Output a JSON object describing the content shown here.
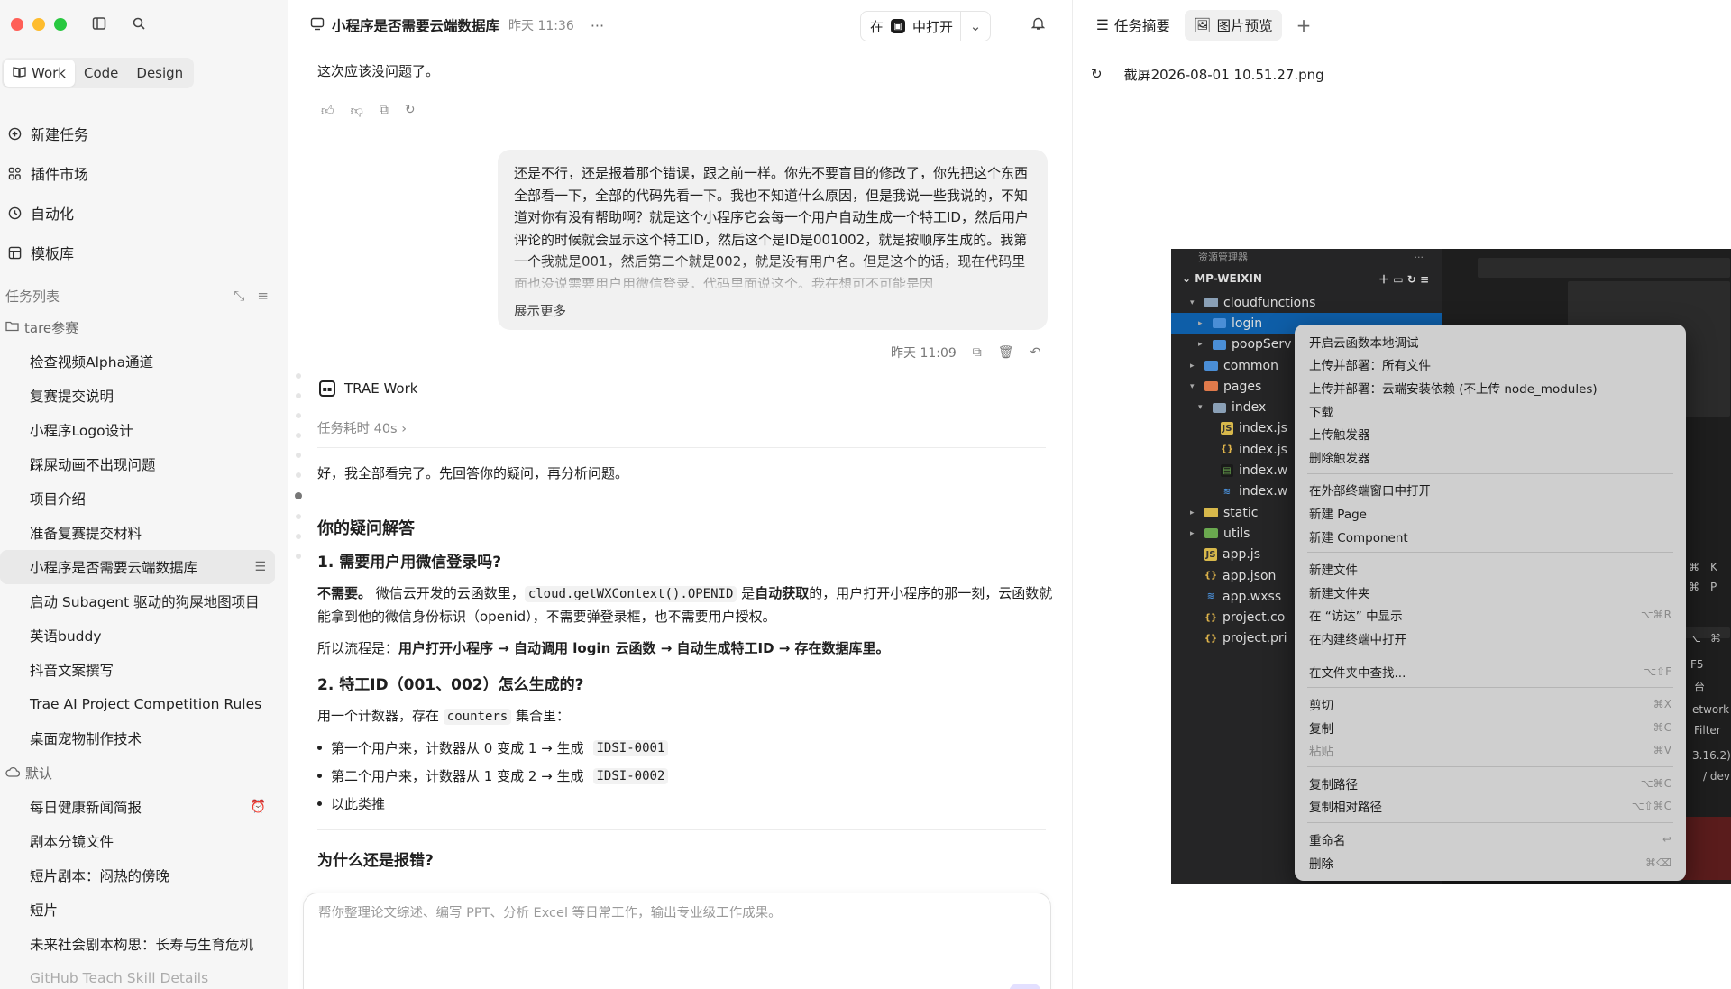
{
  "sidebar": {
    "modes": [
      "Work",
      "Code",
      "Design"
    ],
    "nav": [
      {
        "label": "新建任务",
        "icon": "plus-circle-icon"
      },
      {
        "label": "插件市场",
        "icon": "plugin-grid-icon"
      },
      {
        "label": "自动化",
        "icon": "clock-icon"
      },
      {
        "label": "模板库",
        "icon": "template-icon"
      }
    ],
    "task_list_title": "任务列表",
    "groups": [
      {
        "name": "tare参赛",
        "tasks": [
          "检查视频Alpha通道",
          "复赛提交说明",
          "小程序Logo设计",
          "踩屎动画不出现问题",
          "项目介绍",
          "准备复赛提交材料",
          "小程序是否需要云端数据库",
          "启动 Subagent 驱动的狗屎地图项目",
          "英语buddy",
          "抖音文案撰写",
          "Trae AI Project Competition Rules",
          "桌面宠物制作技术"
        ]
      },
      {
        "name": "默认",
        "tasks": [
          "每日健康新闻简报",
          "剧本分镜文件",
          "短片剧本：闷热的傍晚",
          "短片",
          "未来社会剧本构思：长寿与生育危机",
          "GitHub Teach Skill Details"
        ]
      }
    ]
  },
  "main": {
    "title": "小程序是否需要云端数据库",
    "time": "昨天 11:36",
    "open_in_prefix": "在",
    "open_in_suffix": "中打开",
    "prev_reply": "这次应该没问题了。",
    "user_message": "还是不行，还是报着那个错误，跟之前一样。你先不要盲目的修改了，你先把这个东西全部看一下，全部的代码先看一下。我也不知道什么原因，但是我说一些我说的，不知道对你有没有帮助啊？就是这个小程序它会每一个用户自动生成一个特工ID，然后用户评论的时候就会显示这个特工ID，然后这个是ID是001002，就是按顺序生成的。我第一个我就是001，然后第二个就是002，就是没有用户名。但是这个的话，现在代码里面也没说需要用户用微信登录，代码里面说这个。我在想可不可能是因",
    "show_more": "展示更多",
    "user_time": "昨天 11:09",
    "agent_name": "TRAE Work",
    "duration": "任务耗时 40s",
    "answer": {
      "intro": "好，我全部看完了。先回答你的疑问，再分析问题。",
      "h_questions": "你的疑问解答",
      "q1": "1. 需要用户用微信登录吗?",
      "q1_bold": "不需要。",
      "q1_text1": "微信云开发的云函数里，",
      "q1_code": "cloud.getWXContext().OPENID",
      "q1_text2": "是",
      "q1_bold2": "自动获取",
      "q1_text3": "的，用户打开小程序的那一刻，云函数就能拿到他的微信身份标识（openid），不需要弹登录框，也不需要用户授权。",
      "flow_label": "所以流程是：",
      "flow_text": "用户打开小程序 → 自动调用 login 云函数 → 自动生成特工ID → 存在数据库里。",
      "q2": "2. 特工ID（001、002）怎么生成的?",
      "counter_text1": "用一个计数器，存在",
      "counter_code": "counters",
      "counter_text2": "集合里：",
      "bullet1_text": "第一个用户来，计数器从 0 变成 1 → 生成",
      "bullet1_code": "IDSI-0001",
      "bullet2_text": "第二个用户来，计数器从 1 变成 2 → 生成",
      "bullet2_code": "IDSI-0002",
      "bullet3_text": "以此类推",
      "why": "为什么还是报错?"
    },
    "input_placeholder": "帮你整理论文综述、编写 PPT、分析 Excel 等日常工作，输出专业级工作成果。"
  },
  "panel": {
    "tabs": [
      {
        "label": "任务摘要",
        "icon": "list-icon"
      },
      {
        "label": "图片预览",
        "icon": "image-icon"
      }
    ],
    "file_name": "截屏2026-08-01 10.51.27.png",
    "screenshot": {
      "explorer_title": "资源管理器",
      "project": "MP-WEIXIN",
      "tree": [
        {
          "label": "cloudfunctions",
          "level": 1,
          "caret": "▾",
          "icon": "folder-gray"
        },
        {
          "label": "login",
          "level": 2,
          "caret": "▸",
          "icon": "folder-blue",
          "sel": true
        },
        {
          "label": "poopServ",
          "level": 2,
          "caret": "▸",
          "icon": "folder-blue"
        },
        {
          "label": "common",
          "level": 1,
          "caret": "▸",
          "icon": "folder-blue"
        },
        {
          "label": "pages",
          "level": 1,
          "caret": "▾",
          "icon": "folder-orange"
        },
        {
          "label": "index",
          "level": 2,
          "caret": "▾",
          "icon": "folder-gray"
        },
        {
          "label": "index.js",
          "level": 3,
          "caret": "",
          "icon": "js"
        },
        {
          "label": "index.js",
          "level": 3,
          "caret": "",
          "icon": "json"
        },
        {
          "label": "index.w",
          "level": 3,
          "caret": "",
          "icon": "wx"
        },
        {
          "label": "index.w",
          "level": 3,
          "caret": "",
          "icon": "css"
        },
        {
          "label": "static",
          "level": 1,
          "caret": "▸",
          "icon": "folder-yellow"
        },
        {
          "label": "utils",
          "level": 1,
          "caret": "▸",
          "icon": "folder-green"
        },
        {
          "label": "app.js",
          "level": 1,
          "caret": "",
          "icon": "js"
        },
        {
          "label": "app.json",
          "level": 1,
          "caret": "",
          "icon": "json"
        },
        {
          "label": "app.wxss",
          "level": 1,
          "caret": "",
          "icon": "css"
        },
        {
          "label": "project.co",
          "level": 1,
          "caret": "",
          "icon": "json"
        },
        {
          "label": "project.pri",
          "level": 1,
          "caret": "",
          "icon": "json"
        }
      ],
      "menu": [
        {
          "label": "开启云函数本地调试",
          "key": ""
        },
        {
          "label": "上传并部署：所有文件",
          "key": ""
        },
        {
          "label": "上传并部署：云端安装依赖 (不上传 node_modules)",
          "key": ""
        },
        {
          "label": "下载",
          "key": ""
        },
        {
          "label": "上传触发器",
          "key": ""
        },
        {
          "label": "删除触发器",
          "key": ""
        },
        {
          "sep": true
        },
        {
          "label": "在外部终端窗口中打开",
          "key": ""
        },
        {
          "label": "新建 Page",
          "key": ""
        },
        {
          "label": "新建 Component",
          "key": ""
        },
        {
          "sep": true
        },
        {
          "label": "新建文件",
          "key": ""
        },
        {
          "label": "新建文件夹",
          "key": ""
        },
        {
          "label": "在 “访达” 中显示",
          "key": "⌥⌘R"
        },
        {
          "label": "在内建终端中打开",
          "key": ""
        },
        {
          "sep": true
        },
        {
          "label": "在文件夹中查找...",
          "key": "⌥⇧F"
        },
        {
          "sep": true
        },
        {
          "label": "剪切",
          "key": "⌘X"
        },
        {
          "label": "复制",
          "key": "⌘C"
        },
        {
          "label": "粘贴",
          "key": "⌘V",
          "disabled": true
        },
        {
          "sep": true
        },
        {
          "label": "复制路径",
          "key": "⌥⌘C"
        },
        {
          "label": "复制相对路径",
          "key": "⌥⇧⌘C"
        },
        {
          "sep": true
        },
        {
          "label": "重命名",
          "key": "↩"
        },
        {
          "label": "删除",
          "key": "⌘⌫"
        }
      ],
      "strip": [
        "⌘",
        "K",
        "⌘",
        "P",
        "⌥",
        "⌘",
        "F5",
        "台",
        "etwork",
        "Filter",
        "3.16.2)",
        "/ dev"
      ]
    }
  }
}
